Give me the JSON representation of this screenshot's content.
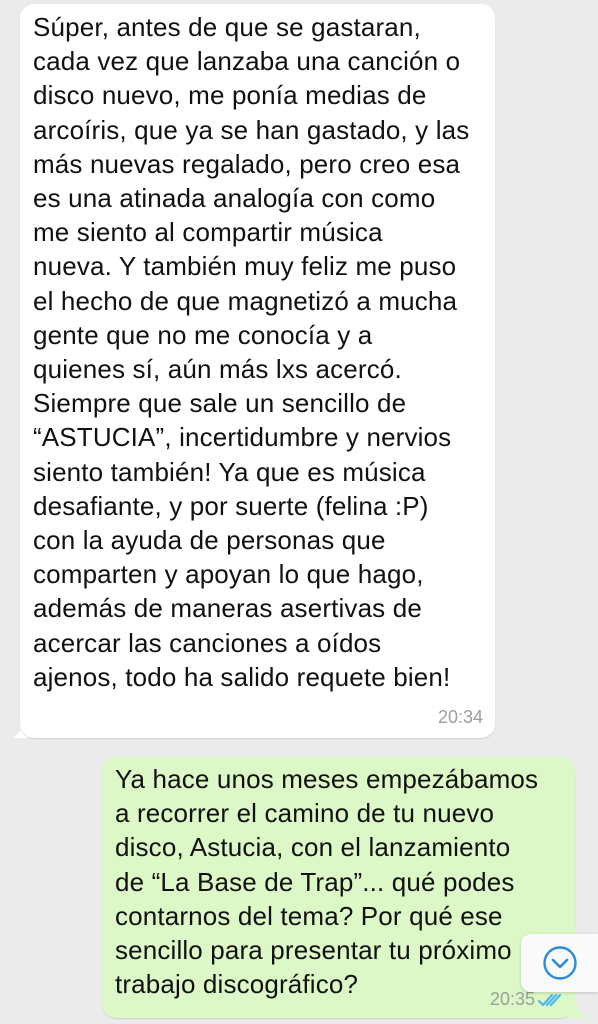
{
  "conversation": {
    "incoming": {
      "lines": [
        "Súper, antes de que se gastaran,",
        "cada vez que lanzaba una canción o",
        "disco nuevo, me ponía medias de",
        "arcoíris, que ya se han gastado, y las",
        "más nuevas regalado, pero creo esa",
        "es una atinada analogía con como",
        "me siento al compartir música",
        "nueva. Y también muy feliz me puso",
        "el hecho de que magnetizó a mucha",
        "gente que no me conocía y a",
        "quienes sí, aún más lxs acercó.",
        "Siempre que sale un sencillo de",
        "“ASTUCIA”, incertidumbre y nervios",
        "siento también! Ya que es música",
        "desafiante, y por suerte (felina :P)",
        "con la ayuda de personas que",
        "comparten y apoyan lo que hago,",
        "además de maneras asertivas de",
        "acercar las canciones a oídos",
        "ajenos, todo ha salido requete bien!"
      ],
      "time": "20:34"
    },
    "outgoing": {
      "lines": [
        "Ya hace unos meses empezábamos",
        "a recorrer el camino de tu nuevo",
        "disco, Astucia, con el lanzamiento",
        "de “La Base de Trap”... qué podes",
        "contarnos del tema? Por qué ese",
        "sencillo para presentar tu próximo",
        "trabajo discográfico?"
      ],
      "time": "20:35",
      "status_icon": "double-check-read-icon"
    }
  },
  "scroll_button": {
    "icon": "chevron-down-circle-icon"
  },
  "colors": {
    "background": "#ebebeb",
    "incoming_bubble": "#ffffff",
    "outgoing_bubble": "#dcf8c6",
    "read_checks": "#4fb6ec",
    "scroll_icon": "#2a8bd8"
  }
}
